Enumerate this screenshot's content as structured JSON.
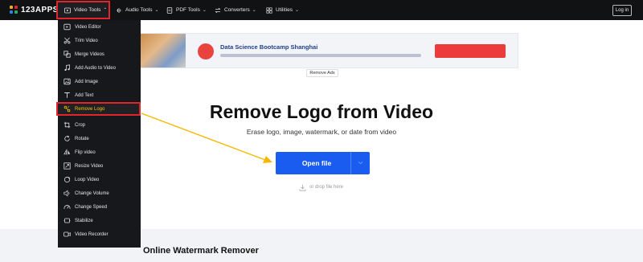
{
  "brand": {
    "name": "123APPS",
    "logo_colors": [
      "#f5a623",
      "#e3242b",
      "#2f80ed",
      "#27ae60"
    ]
  },
  "nav": {
    "items": [
      {
        "label": "Video Tools",
        "icon": "video-icon",
        "open": true
      },
      {
        "label": "Audio Tools",
        "icon": "waveform-icon"
      },
      {
        "label": "PDF Tools",
        "icon": "pdf-icon"
      },
      {
        "label": "Converters",
        "icon": "converter-icon"
      },
      {
        "label": "Utilities",
        "icon": "utilities-icon"
      }
    ],
    "login_label": "Log in"
  },
  "dropdown": {
    "items": [
      {
        "label": "Video Editor",
        "icon": "video-editor-icon"
      },
      {
        "label": "Trim Video",
        "icon": "scissors-icon"
      },
      {
        "label": "Merge Videos",
        "icon": "merge-icon"
      },
      {
        "label": "Add Audio to Video",
        "icon": "music-note-icon"
      },
      {
        "label": "Add Image",
        "icon": "image-icon"
      },
      {
        "label": "Add Text",
        "icon": "text-icon"
      },
      {
        "label": "Remove Logo",
        "icon": "remove-logo-icon",
        "active": true
      },
      {
        "label": "Crop",
        "icon": "crop-icon"
      },
      {
        "label": "Rotate",
        "icon": "rotate-icon"
      },
      {
        "label": "Flip video",
        "icon": "flip-icon"
      },
      {
        "label": "Resize Video",
        "icon": "resize-icon"
      },
      {
        "label": "Loop Video",
        "icon": "loop-icon"
      },
      {
        "label": "Change Volume",
        "icon": "volume-icon"
      },
      {
        "label": "Change Speed",
        "icon": "speed-icon"
      },
      {
        "label": "Stabilize",
        "icon": "stabilize-icon"
      },
      {
        "label": "Video Recorder",
        "icon": "record-icon"
      }
    ]
  },
  "ad": {
    "title": "Data Science Bootcamp Shanghai",
    "remove_label": "Remove Ads"
  },
  "hero": {
    "title": "Remove Logo from Video",
    "subtitle": "Erase logo, image, watermark, or date from video",
    "open_label": "Open file",
    "drop_hint": "or drop file here"
  },
  "lower": {
    "title": "Online Watermark Remover"
  },
  "colors": {
    "accent": "#1a5cf0",
    "highlight_border": "#e3242b",
    "annotation_arrow": "#f5b800",
    "nav_bg": "#111214"
  }
}
